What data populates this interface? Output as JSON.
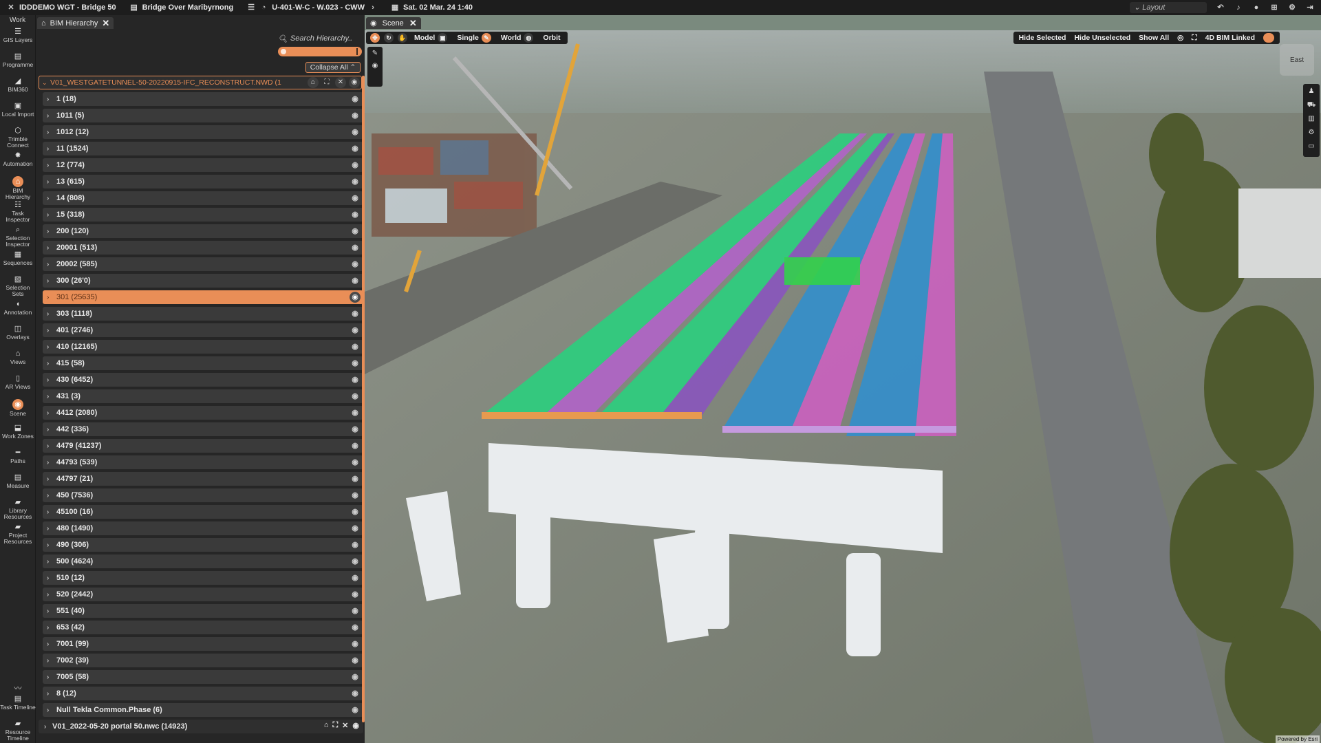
{
  "topbar": {
    "project": "IDDDEMO WGT - Bridge 50",
    "document": "Bridge Over Maribyrnong",
    "schedule": "U-401-W-C - W.023 - CWW",
    "date": "Sat. 02 Mar. 24 1:40",
    "layout": "Layout"
  },
  "sidebar": {
    "work_label": "Work",
    "items": [
      {
        "label": "GIS Layers",
        "icon": "layers-icon"
      },
      {
        "label": "Programme",
        "icon": "document-icon"
      },
      {
        "label": "BIM360",
        "icon": "bim360-icon"
      },
      {
        "label": "Local Import",
        "icon": "import-icon"
      },
      {
        "label": "Trimble Connect",
        "icon": "connect-icon"
      },
      {
        "label": "Automation",
        "icon": "automation-icon"
      },
      {
        "label": "BIM Hierarchy",
        "icon": "hierarchy-icon",
        "active": true
      },
      {
        "label": "Task Inspector",
        "icon": "list-icon"
      },
      {
        "label": "Selection Inspector",
        "icon": "magnifier-icon"
      },
      {
        "label": "Sequences",
        "icon": "sequence-icon"
      },
      {
        "label": "Selection Sets",
        "icon": "selection-sets-icon"
      },
      {
        "label": "Annotation",
        "icon": "speech-bubble-icon"
      },
      {
        "label": "Overlays",
        "icon": "overlay-icon"
      },
      {
        "label": "Views",
        "icon": "home-icon"
      },
      {
        "label": "AR Views",
        "icon": "phone-icon"
      },
      {
        "label": "Scene",
        "icon": "eye-icon",
        "active": true
      },
      {
        "label": "Work Zones",
        "icon": "zone-icon"
      },
      {
        "label": "Paths",
        "icon": "path-icon"
      },
      {
        "label": "Measure",
        "icon": "measure-icon"
      },
      {
        "label": "Library Resources",
        "icon": "library-icon"
      },
      {
        "label": "Project Resources",
        "icon": "folder-icon"
      }
    ],
    "bottom_items": [
      {
        "label": "Task Timeline",
        "icon": "timeline-icon"
      },
      {
        "label": "Resource Timeline",
        "icon": "resource-timeline-icon"
      }
    ]
  },
  "hierarchy": {
    "tab_label": "BIM Hierarchy",
    "search_placeholder": "Search Hierarchy..",
    "collapse_label": "Collapse All",
    "root_label": "V01_WESTGATETUNNEL-50-20220915-IFC_RECONSTRUCT.NWD (1",
    "nodes": [
      {
        "label": "1 (18)"
      },
      {
        "label": "1011 (5)"
      },
      {
        "label": "1012 (12)"
      },
      {
        "label": "11 (1524)"
      },
      {
        "label": "12 (774)"
      },
      {
        "label": "13 (615)"
      },
      {
        "label": "14 (808)"
      },
      {
        "label": "15 (318)"
      },
      {
        "label": "200 (120)"
      },
      {
        "label": "20001 (513)"
      },
      {
        "label": "20002 (585)"
      },
      {
        "label": "300 (26'0)"
      },
      {
        "label": "301 (25635)",
        "selected": true
      },
      {
        "label": "303 (1118)"
      },
      {
        "label": "401 (2746)"
      },
      {
        "label": "410 (12165)"
      },
      {
        "label": "415 (58)"
      },
      {
        "label": "430 (6452)"
      },
      {
        "label": "431 (3)"
      },
      {
        "label": "4412 (2080)"
      },
      {
        "label": "442 (336)"
      },
      {
        "label": "4479 (41237)"
      },
      {
        "label": "44793 (539)"
      },
      {
        "label": "44797 (21)"
      },
      {
        "label": "450 (7536)"
      },
      {
        "label": "45100 (16)"
      },
      {
        "label": "480 (1490)"
      },
      {
        "label": "490 (306)"
      },
      {
        "label": "500 (4624)"
      },
      {
        "label": "510 (12)"
      },
      {
        "label": "520 (2442)"
      },
      {
        "label": "551 (40)"
      },
      {
        "label": "653 (42)"
      },
      {
        "label": "7001 (99)"
      },
      {
        "label": "7002 (39)"
      },
      {
        "label": "7005 (58)"
      },
      {
        "label": "8 (12)"
      },
      {
        "label": "Null Tekla Common.Phase (6)"
      }
    ],
    "root2_label": "V01_2022-05-20 portal 50.nwc (14923)"
  },
  "scene": {
    "tab_label": "Scene",
    "toolbar": {
      "model": "Model",
      "single": "Single",
      "world": "World",
      "orbit": "Orbit"
    },
    "right_toolbar": {
      "hide_selected": "Hide Selected",
      "hide_unselected": "Hide Unselected",
      "show_all": "Show All",
      "bim_linked": "4D BIM Linked"
    },
    "compass": "East",
    "powered": "Powered by Esri"
  }
}
